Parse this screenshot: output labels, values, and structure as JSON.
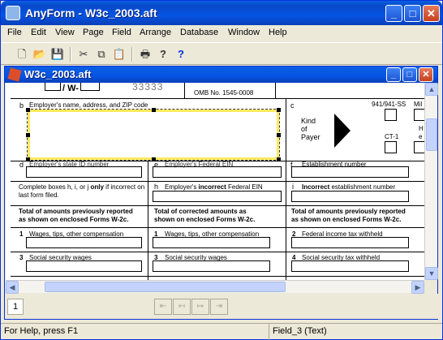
{
  "window": {
    "title": "AnyForm - W3c_2003.aft",
    "minimize": "_",
    "maximize": "□",
    "close": "✕"
  },
  "menu": [
    "File",
    "Edit",
    "View",
    "Page",
    "Field",
    "Arrange",
    "Database",
    "Window",
    "Help"
  ],
  "toolbar": {
    "icons": [
      "new-icon",
      "open-icon",
      "save-icon",
      "cut-icon",
      "copy-icon",
      "paste-icon",
      "print-icon",
      "help-icon",
      "context-help-icon"
    ],
    "glyphs": [
      "🗋",
      "📂",
      "💾",
      "✂",
      "⧉",
      "📋",
      "🖶",
      "?",
      "?"
    ]
  },
  "document": {
    "title": "W3c_2003.aft",
    "minimize": "_",
    "maximize": "□",
    "close": "✕"
  },
  "form": {
    "top_partial_code": "33333",
    "top_partial_w": "/ W-",
    "omb": "OMB No. 1545-0008",
    "b_letter": "b",
    "b_label": "Employer's name, address, and ZIP code",
    "c_letter": "c",
    "c_941": "941/941-SS",
    "c_mil": "Mil",
    "c_ct1": "CT-1",
    "c_h": "H",
    "c_e": "e",
    "kind_of_payer": [
      "Kind",
      "of",
      "Payer"
    ],
    "d_letter": "d",
    "d_label": "Employer's state ID number",
    "e_letter": "e",
    "e_label": "Employer's Federal EIN",
    "f_letter": "f",
    "f_label": "Establishment number",
    "note": "Complete boxes h, i, or j only if incorrect on last form filed.",
    "note_prefix": "Complete boxes h, i, or j ",
    "note_only": "only",
    "note_suffix": " if incorrect on last form filed.",
    "h_letter": "h",
    "h_pre": "Employer's ",
    "h_bold": "incorrect",
    "h_post": " Federal EIN",
    "i_letter": "i",
    "i_bold": "Incorrect",
    "i_post": " establishment number",
    "total_prev_1": "Total of amounts previously reported",
    "total_prev_2": "as shown on enclosed Forms W-2c.",
    "total_corr_1": "Total of corrected amounts as",
    "total_corr_2": "shown on enclosed Forms W-2c.",
    "total_diff_1": "Total of amounts previously reported",
    "total_diff_2": "as shown on enclosed Forms W-2c.",
    "r1": "1",
    "wages": "Wages, tips, other compensation",
    "r2": "2",
    "federal_tax": "Federal income tax withheld",
    "r3": "3",
    "ss_wages": "Social security wages",
    "r4": "4",
    "ss_tax": "Social security tax withheld"
  },
  "page_tab": "1",
  "nav_glyphs": [
    "⇤",
    "↤",
    "↦",
    "⇥"
  ],
  "status": {
    "left": "For Help, press F1",
    "right": "Field_3 (Text)"
  }
}
